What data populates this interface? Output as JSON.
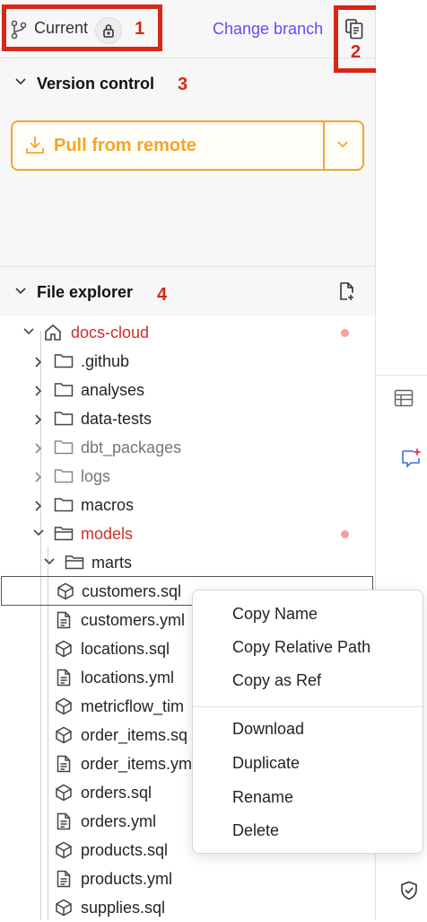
{
  "top_bar": {
    "current_label": "Current",
    "change_branch_label": "Change branch"
  },
  "callouts": [
    "1",
    "2",
    "3",
    "4"
  ],
  "version_control": {
    "title": "Version control",
    "pull_button_label": "Pull from remote"
  },
  "file_explorer": {
    "title": "File explorer",
    "items": [
      {
        "label": "docs-cloud",
        "type": "project",
        "expanded": true,
        "modified": true
      },
      {
        "label": ".github",
        "type": "folder",
        "expanded": false
      },
      {
        "label": "analyses",
        "type": "folder",
        "expanded": false
      },
      {
        "label": "data-tests",
        "type": "folder",
        "expanded": false
      },
      {
        "label": "dbt_packages",
        "type": "folder",
        "expanded": false,
        "muted": true
      },
      {
        "label": "logs",
        "type": "folder",
        "expanded": false,
        "muted": true
      },
      {
        "label": "macros",
        "type": "folder",
        "expanded": false
      },
      {
        "label": "models",
        "type": "folder",
        "expanded": true,
        "modified": true
      },
      {
        "label": "marts",
        "type": "folder",
        "expanded": true
      },
      {
        "label": "customers.sql",
        "type": "model",
        "selected": true
      },
      {
        "label": "customers.yml",
        "type": "yml"
      },
      {
        "label": "locations.sql",
        "type": "model"
      },
      {
        "label": "locations.yml",
        "type": "yml"
      },
      {
        "label": "metricflow_tim",
        "type": "model"
      },
      {
        "label": "order_items.sq",
        "type": "model"
      },
      {
        "label": "order_items.ym",
        "type": "yml"
      },
      {
        "label": "orders.sql",
        "type": "model"
      },
      {
        "label": "orders.yml",
        "type": "yml"
      },
      {
        "label": "products.sql",
        "type": "model"
      },
      {
        "label": "products.yml",
        "type": "yml"
      },
      {
        "label": "supplies.sql",
        "type": "model"
      }
    ]
  },
  "context_menu": {
    "group1": [
      "Copy Name",
      "Copy Relative Path",
      "Copy as Ref"
    ],
    "group2": [
      "Download",
      "Duplicate",
      "Rename",
      "Delete"
    ]
  },
  "icons": {
    "branch": "git-branch-icon",
    "lock": "lock-icon",
    "copy": "copy-document-icon",
    "download": "download-icon",
    "new_file": "new-file-icon",
    "home": "home-icon",
    "folder": "folder-icon",
    "model": "cube-icon",
    "yml": "document-icon",
    "table": "table-icon",
    "ai": "sparkle-chat-icon",
    "shield": "shield-check-icon"
  },
  "colors": {
    "callout_red": "#d92617",
    "accent_purple": "#6e44ff",
    "pull_orange": "#f2a629",
    "modified_red": "#c9302c"
  }
}
